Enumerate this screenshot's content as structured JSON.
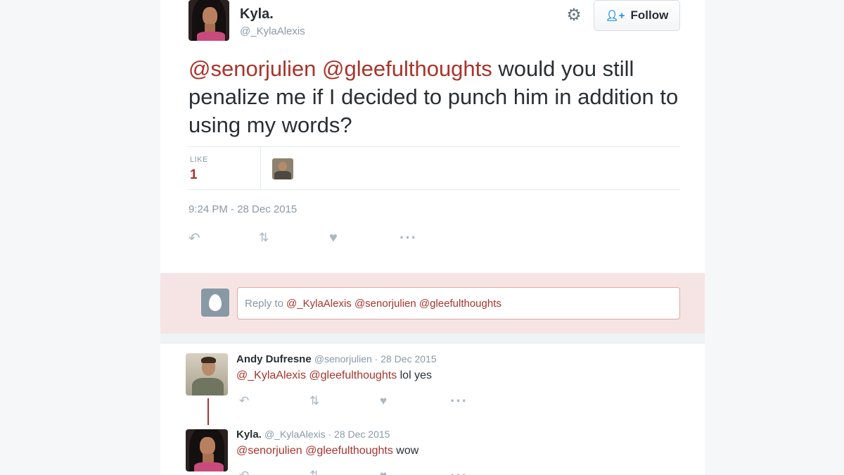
{
  "tweet": {
    "author_name": "Kyla.",
    "author_handle": "@_KylaAlexis",
    "follow_label": "Follow",
    "text_mention_1": "@senorjulien",
    "text_mention_2": "@gleefulthoughts",
    "text_body": " would you still penalize me if I decided to punch him in addition to using my words?",
    "like_label": "LIKE",
    "like_count": "1",
    "timestamp": "9:24 PM - 28 Dec 2015"
  },
  "icons": {
    "gear": "gear-icon",
    "follow": "follow-user-icon",
    "reply": "reply-icon",
    "retweet": "retweet-icon",
    "like": "heart-icon",
    "more": "more-icon"
  },
  "reply_box": {
    "prefix": "Reply to",
    "recipients": "@_KylaAlexis @senorjulien @gleefulthoughts"
  },
  "replies": [
    {
      "name": "Andy Dufresne",
      "handle_date": "@senorjulien · 28 Dec 2015",
      "mentions": "@_KylaAlexis @gleefulthoughts",
      "text": " lol yes"
    },
    {
      "name": "Kyla.",
      "handle_date": "@_KylaAlexis · 28 Dec 2015",
      "mentions": "@senorjulien @gleefulthoughts",
      "text": " wow"
    }
  ],
  "colors": {
    "mention": "#a8342b",
    "reply_area_bg": "#f6e4e4",
    "muted": "#8899a6"
  }
}
